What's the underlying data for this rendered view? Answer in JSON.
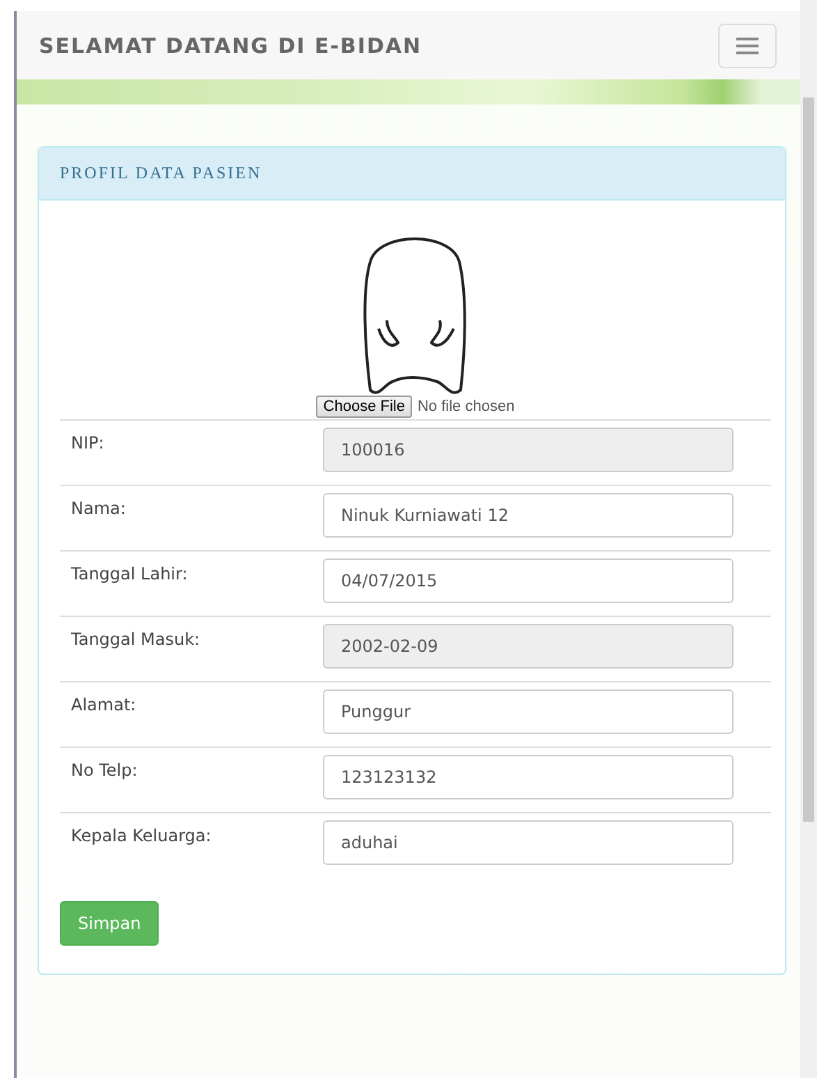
{
  "navbar": {
    "title": "SELAMAT DATANG DI E-BIDAN"
  },
  "panel": {
    "heading": "PROFIL DATA PASIEN",
    "file_input": {
      "button": "Choose File",
      "status": "No file chosen"
    },
    "fields": [
      {
        "label": "NIP:",
        "value": "100016",
        "disabled": true
      },
      {
        "label": "Nama:",
        "value": "Ninuk Kurniawati 12",
        "disabled": false
      },
      {
        "label": "Tanggal Lahir:",
        "value": "04/07/2015",
        "disabled": false
      },
      {
        "label": "Tanggal Masuk:",
        "value": "2002-02-09",
        "disabled": true
      },
      {
        "label": "Alamat:",
        "value": "Punggur",
        "disabled": false
      },
      {
        "label": "No Telp:",
        "value": "123123132",
        "disabled": false
      },
      {
        "label": "Kepala Keluarga:",
        "value": "aduhai",
        "disabled": false
      }
    ],
    "submit": "Simpan"
  }
}
